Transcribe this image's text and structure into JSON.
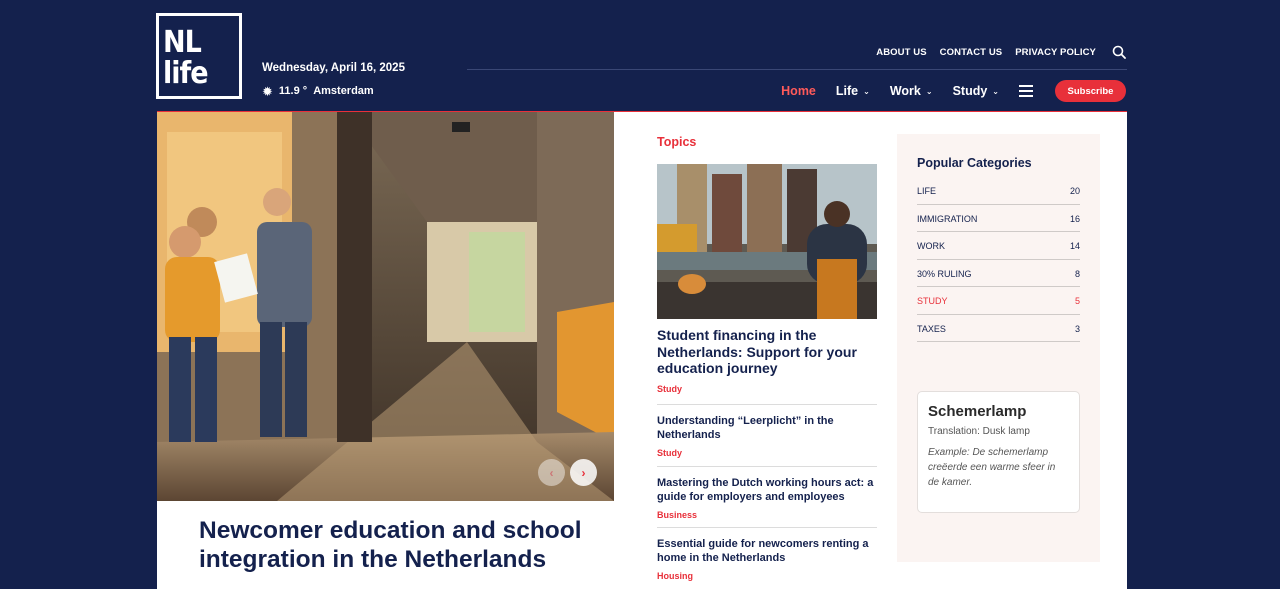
{
  "brand": {
    "logo_line1": "NL",
    "logo_line2": "life"
  },
  "header": {
    "date": "Wednesday, April 16, 2025",
    "weather": {
      "temperature": "11.9",
      "unit": "°",
      "city": "Amsterdam",
      "icon": "sun-icon"
    }
  },
  "top_links": [
    "ABOUT US",
    "CONTACT US",
    "PRIVACY POLICY"
  ],
  "main_nav": {
    "home": "Home",
    "life": "Life",
    "work": "Work",
    "study": "Study",
    "subscribe": "Subscribe"
  },
  "hero": {
    "title": "Newcomer education and school integration in the Netherlands",
    "prev_icon": "‹",
    "next_icon": "›"
  },
  "topics": {
    "heading": "Topics",
    "feature": {
      "title": "Student financing in the Netherlands: Support for your education journey",
      "category": "Study"
    },
    "articles": [
      {
        "title": "Understanding “Leerplicht” in the Netherlands",
        "category": "Study"
      },
      {
        "title": "Mastering the Dutch working hours act: a guide for employers and employees",
        "category": "Business"
      },
      {
        "title": "Essential guide for newcomers renting a home in the Netherlands",
        "category": "Housing"
      }
    ]
  },
  "sidebar": {
    "heading": "Popular Categories",
    "categories": [
      {
        "name": "LIFE",
        "count": "20"
      },
      {
        "name": "IMMIGRATION",
        "count": "16"
      },
      {
        "name": "WORK",
        "count": "14"
      },
      {
        "name": "30% RULING",
        "count": "8"
      },
      {
        "name": "STUDY",
        "count": "5"
      },
      {
        "name": "TAXES",
        "count": "3"
      }
    ],
    "word_of_day": {
      "word": "Schemerlamp",
      "translation": "Translation: Dusk lamp",
      "example": "Example: De schemerlamp creëerde een warme sfeer in de kamer."
    }
  },
  "colors": {
    "navy": "#14214d",
    "accent": "#e8303a",
    "sidebar_bg": "#fbf4f2"
  }
}
